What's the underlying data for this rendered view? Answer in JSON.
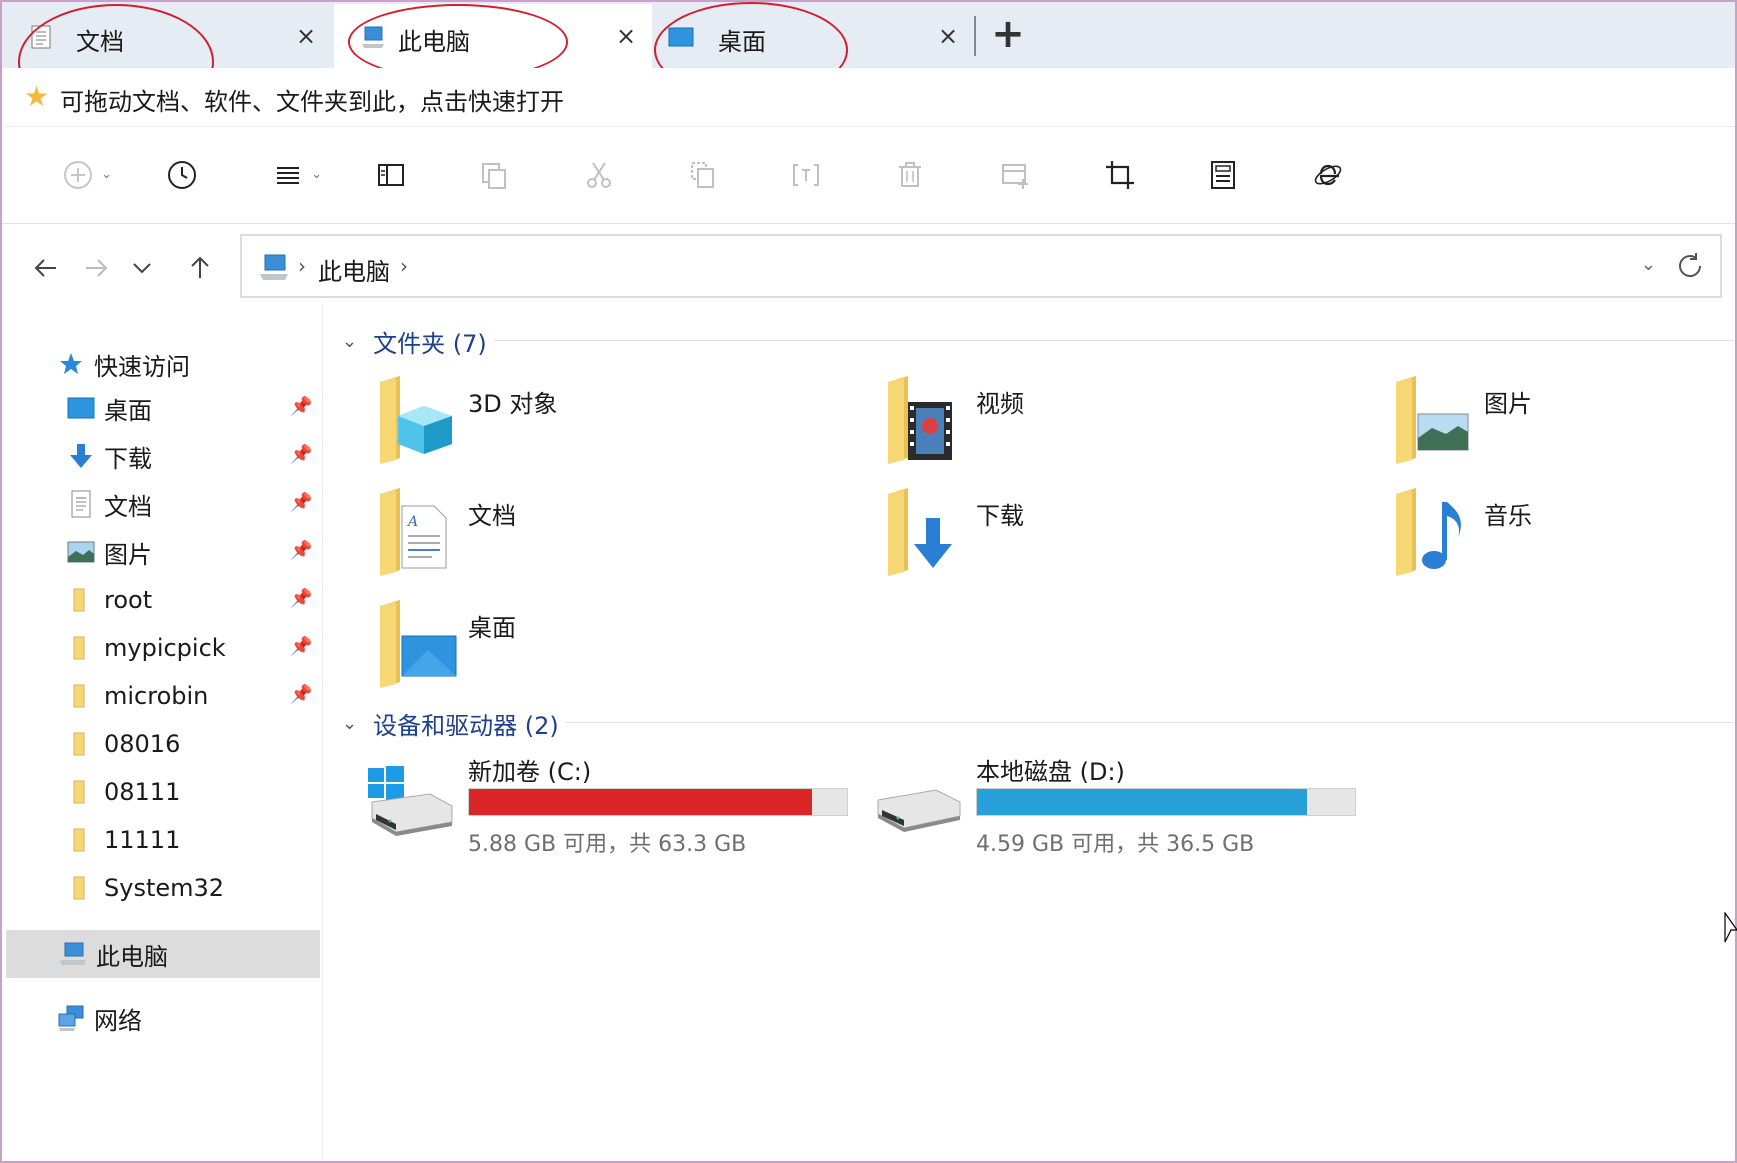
{
  "tabs": [
    {
      "label": "文档",
      "close": "×",
      "icon": "document-icon"
    },
    {
      "label": "此电脑",
      "close": "×",
      "icon": "computer-icon"
    },
    {
      "label": "桌面",
      "close": "×",
      "icon": "desktop-icon"
    }
  ],
  "tab_add": "+",
  "favbar": {
    "hint": "可拖动文档、软件、文件夹到此，点击快速打开",
    "icon": "star-icon"
  },
  "address": {
    "crumb": "此电脑",
    "separator": "›"
  },
  "nav": {
    "quick_access": "快速访问",
    "pinned": [
      {
        "label": "桌面",
        "icon": "desktop-icon"
      },
      {
        "label": "下载",
        "icon": "download-icon"
      },
      {
        "label": "文档",
        "icon": "document-icon"
      },
      {
        "label": "图片",
        "icon": "picture-icon"
      },
      {
        "label": "root",
        "icon": "folder-icon"
      },
      {
        "label": "mypicpick",
        "icon": "folder-icon"
      },
      {
        "label": "microbin",
        "icon": "folder-icon"
      }
    ],
    "unpinned": [
      {
        "label": "08016",
        "icon": "folder-icon"
      },
      {
        "label": "08111",
        "icon": "folder-icon"
      },
      {
        "label": "11111",
        "icon": "folder-icon"
      },
      {
        "label": "System32",
        "icon": "folder-icon"
      }
    ],
    "this_pc": "此电脑",
    "network": "网络"
  },
  "content": {
    "folders_header": "文件夹 (7)",
    "folders": [
      {
        "label": "3D 对象",
        "icon": "3d-objects-icon"
      },
      {
        "label": "视频",
        "icon": "video-icon"
      },
      {
        "label": "图片",
        "icon": "picture-icon"
      },
      {
        "label": "文档",
        "icon": "document-icon"
      },
      {
        "label": "下载",
        "icon": "download-icon"
      },
      {
        "label": "音乐",
        "icon": "music-icon"
      },
      {
        "label": "桌面",
        "icon": "desktop-icon"
      }
    ],
    "drives_header": "设备和驱动器 (2)",
    "drives": [
      {
        "name": "新加卷 (C:)",
        "info": "5.88 GB 可用，共 63.3 GB",
        "used_fraction": 0.907,
        "color": "#da2626",
        "icon": "windows-drive-icon"
      },
      {
        "name": "本地磁盘 (D:)",
        "info": "4.59 GB 可用，共 36.5 GB",
        "used_fraction": 0.874,
        "color": "#26a0da",
        "icon": "hard-drive-icon"
      }
    ]
  },
  "colors": {
    "accent": "#1e3f8a",
    "annotation": "#d02030",
    "folder": "#f7d774"
  }
}
